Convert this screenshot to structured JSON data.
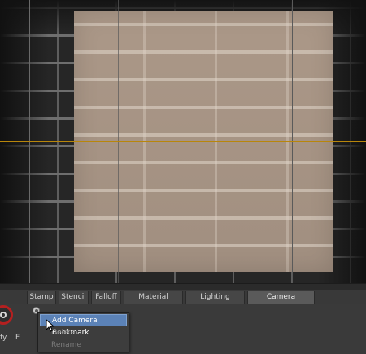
{
  "tabs": [
    {
      "label": "Stamp",
      "active": false
    },
    {
      "label": "Stencil",
      "active": false
    },
    {
      "label": "Falloff",
      "active": false
    },
    {
      "label": "Material Presets",
      "active": false
    },
    {
      "label": "Lighting Presets",
      "active": false
    },
    {
      "label": "Camera Bookmarks",
      "active": true
    }
  ],
  "left_labels": [
    "fy",
    "F"
  ],
  "context_menu": {
    "items": [
      {
        "label": "Add Camera Bookmark",
        "state": "highlighted"
      },
      {
        "label": "Delete",
        "state": "disabled"
      },
      {
        "label": "Rename",
        "state": "disabled"
      }
    ]
  },
  "icons": {
    "left_tool": "brush-tool-icon",
    "camera_add": "add-bookmark-icon",
    "cursor": "mouse-pointer-icon"
  },
  "colors": {
    "highlight": "#5b82b7",
    "guide": "#b8860b",
    "tool_ring": "#b52020"
  }
}
